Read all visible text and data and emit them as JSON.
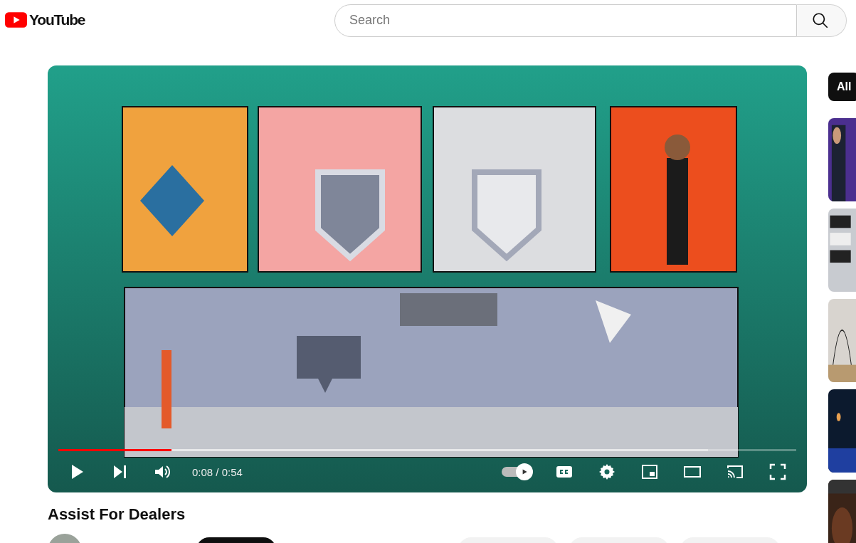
{
  "header": {
    "logo": "YouTube",
    "search": {
      "placeholder": "Search"
    }
  },
  "player": {
    "progress": {
      "level": 0.153
    },
    "time": "0:08 / 0:54",
    "autoplay": {
      "on": true
    }
  },
  "video": {
    "title": "Assist For Dealers"
  },
  "sidebar": {
    "chips": [
      {
        "label": "All",
        "selected": true
      }
    ]
  }
}
